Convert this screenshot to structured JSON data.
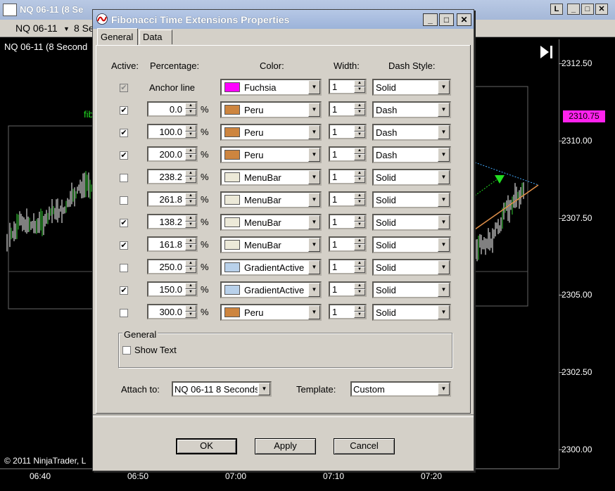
{
  "chart_window": {
    "title": "NQ 06-11 (8 Se",
    "instrument": "NQ 06-11",
    "interval": "8 Se",
    "panel_label": "NQ 06-11 (8 Second",
    "stray_label": "fib",
    "price_ticks": [
      "2312.50",
      "2310.00",
      "2307.50",
      "2305.00",
      "2302.50",
      "2300.00"
    ],
    "current_price": "2310.75",
    "time_ticks": [
      "06:40",
      "06:50",
      "07:00",
      "07:10",
      "07:20"
    ],
    "copyright": "© 2011 NinjaTrader, L",
    "winbtn_min": "L",
    "winbtn_close": "✕",
    "colors": {
      "current_price_bg": "#ff22ee",
      "bars": "#ffffff"
    }
  },
  "dialog": {
    "title": "Fibonacci Time Extensions Properties",
    "tabs": [
      {
        "label": "General"
      },
      {
        "label": "Data"
      }
    ],
    "headers": {
      "active": "Active:",
      "percentage": "Percentage:",
      "color": "Color:",
      "width": "Width:",
      "dash_style": "Dash Style:"
    },
    "anchor_row": {
      "label": "Anchor line",
      "color": "Fuchsia",
      "color_hex": "#ff00ff",
      "width": "1",
      "dash": "Solid"
    },
    "rows": [
      {
        "checked": true,
        "pct": "0.0",
        "color": "Peru",
        "color_hex": "#cd853f",
        "width": "1",
        "dash": "Dash"
      },
      {
        "checked": true,
        "pct": "100.0",
        "color": "Peru",
        "color_hex": "#cd853f",
        "width": "1",
        "dash": "Dash"
      },
      {
        "checked": true,
        "pct": "200.0",
        "color": "Peru",
        "color_hex": "#cd853f",
        "width": "1",
        "dash": "Dash"
      },
      {
        "checked": false,
        "pct": "238.2",
        "color": "MenuBar",
        "color_hex": "#ece9d8",
        "width": "1",
        "dash": "Solid"
      },
      {
        "checked": false,
        "pct": "261.8",
        "color": "MenuBar",
        "color_hex": "#ece9d8",
        "width": "1",
        "dash": "Solid"
      },
      {
        "checked": true,
        "pct": "138.2",
        "color": "MenuBar",
        "color_hex": "#ece9d8",
        "width": "1",
        "dash": "Solid"
      },
      {
        "checked": true,
        "pct": "161.8",
        "color": "MenuBar",
        "color_hex": "#ece9d8",
        "width": "1",
        "dash": "Solid"
      },
      {
        "checked": false,
        "pct": "250.0",
        "color": "GradientActive",
        "color_hex": "#b9d1ea",
        "width": "1",
        "dash": "Solid"
      },
      {
        "checked": true,
        "pct": "150.0",
        "color": "GradientActive",
        "color_hex": "#b9d1ea",
        "width": "1",
        "dash": "Solid"
      },
      {
        "checked": false,
        "pct": "300.0",
        "color": "Peru",
        "color_hex": "#cd853f",
        "width": "1",
        "dash": "Solid"
      }
    ],
    "percent_sign": "%",
    "general_group": {
      "title": "General",
      "show_text_label": "Show Text",
      "show_text_checked": false
    },
    "attach_to_label": "Attach to:",
    "attach_to_value": "NQ 06-11 8 Seconds",
    "template_label": "Template:",
    "template_value": "Custom",
    "buttons": {
      "ok": "OK",
      "apply": "Apply",
      "cancel": "Cancel"
    },
    "check_glyph": "✔"
  }
}
